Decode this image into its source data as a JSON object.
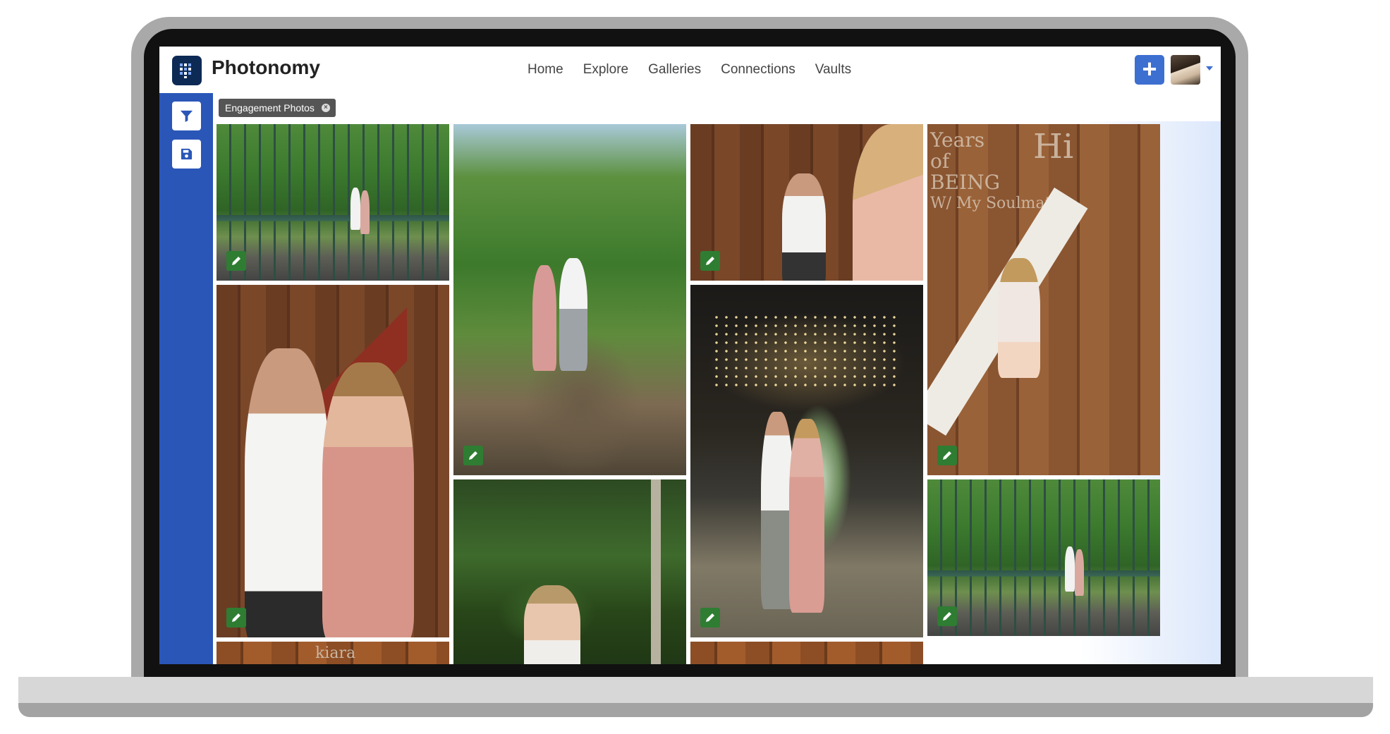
{
  "app": {
    "brand": "Photonomy",
    "nav": [
      "Home",
      "Explore",
      "Galleries",
      "Connections",
      "Vaults"
    ]
  },
  "header": {
    "add_label": "+",
    "avatar_alt": "user avatar"
  },
  "sidebar": {
    "items": [
      {
        "name": "filter",
        "icon": "funnel-icon"
      },
      {
        "name": "save",
        "icon": "floppy-disk-icon"
      }
    ]
  },
  "filters": {
    "active_tag": "Engagement Photos"
  },
  "gallery": {
    "photos": [
      {
        "scene": "couple on green bridge in park",
        "editable": true
      },
      {
        "scene": "couple walking on dirt path under trees",
        "editable": true
      },
      {
        "scene": "man behind woman in barn, woman's raised hand",
        "editable": true
      },
      {
        "scene": "toddler girl against wooden wall with chalk writing",
        "editable": true
      },
      {
        "scene": "couple embracing in covered bridge",
        "editable": true
      },
      {
        "scene": "couple standing in covered bridge tunnel with string lights",
        "editable": true
      },
      {
        "scene": "woman among green foliage",
        "editable": false
      },
      {
        "scene": "couple on green bridge, wider view",
        "editable": true
      },
      {
        "scene": "wooden wall with chalk writing",
        "editable": false
      },
      {
        "scene": "covered bridge wooden beams",
        "editable": false
      }
    ],
    "chalk_text": [
      "Years",
      "of",
      "BEING",
      "W/ My Soulmate",
      "Hi"
    ]
  }
}
